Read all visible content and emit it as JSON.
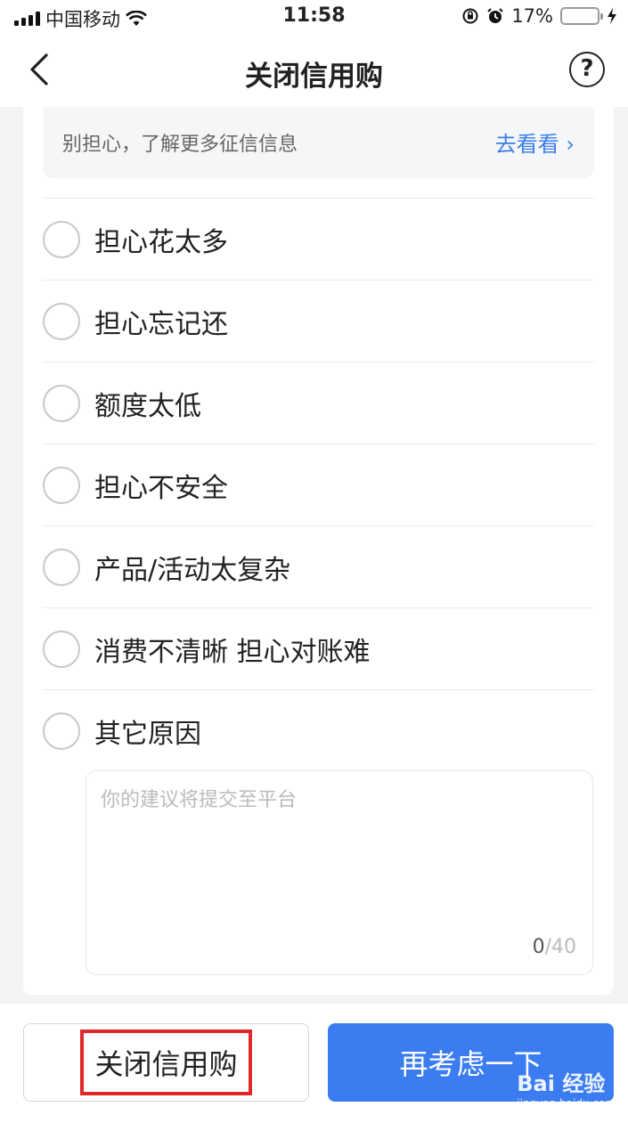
{
  "status_bar": {
    "carrier": "中国移动",
    "time": "11:58",
    "battery": "17%",
    "battery_level": 0.17,
    "icons": [
      "signal-icon",
      "wifi-icon",
      "rotation-lock-icon",
      "alarm-icon",
      "battery-icon",
      "charging-icon"
    ]
  },
  "nav": {
    "title": "关闭信用购",
    "help_symbol": "?"
  },
  "banner": {
    "message": "别担心，了解更多征信信息",
    "link_label": "去看看 ›"
  },
  "reasons": [
    {
      "label": "担心花太多"
    },
    {
      "label": "担心忘记还"
    },
    {
      "label": "额度太低"
    },
    {
      "label": "担心不安全"
    },
    {
      "label": "产品/活动太复杂"
    },
    {
      "label": "消费不清晰 担心对账难"
    },
    {
      "label": "其它原因"
    }
  ],
  "feedback": {
    "placeholder": "你的建议将提交至平台",
    "current": "0",
    "max": "/40"
  },
  "actions": {
    "close_label": "关闭信用购",
    "reconsider_label": "再考虑一下"
  },
  "watermark": {
    "text": "Bai 经验",
    "sub": "jingyan.baidu.com"
  },
  "colors": {
    "accent": "#3b7cf0",
    "highlight": "#e02828",
    "battery_low": "#e63232"
  }
}
